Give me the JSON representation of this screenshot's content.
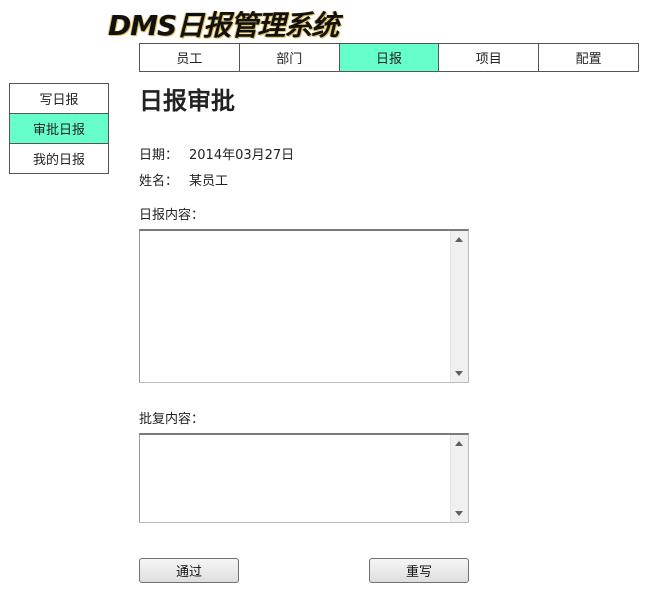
{
  "app": {
    "logo_text": "DMS日报管理系统"
  },
  "topnav": {
    "tabs": [
      {
        "label": "员工"
      },
      {
        "label": "部门"
      },
      {
        "label": "日报"
      },
      {
        "label": "项目"
      },
      {
        "label": "配置"
      }
    ],
    "active_index": 2
  },
  "sidebar": {
    "items": [
      {
        "label": "写日报"
      },
      {
        "label": "审批日报"
      },
      {
        "label": "我的日报"
      }
    ],
    "active_index": 1
  },
  "main": {
    "title": "日报审批",
    "date_label": "日期：",
    "date_value": "2014年03月27日",
    "name_label": "姓名：",
    "name_value": "某员工",
    "report_content_label": "日报内容：",
    "report_content_value": "",
    "reply_content_label": "批复内容：",
    "reply_content_value": "",
    "approve_button": "通过",
    "reset_button": "重写"
  },
  "colors": {
    "active_tab": "#66ffcc",
    "border": "#555555"
  },
  "icons": {
    "scroll_up": "scroll-up-arrow-icon",
    "scroll_down": "scroll-down-arrow-icon"
  }
}
